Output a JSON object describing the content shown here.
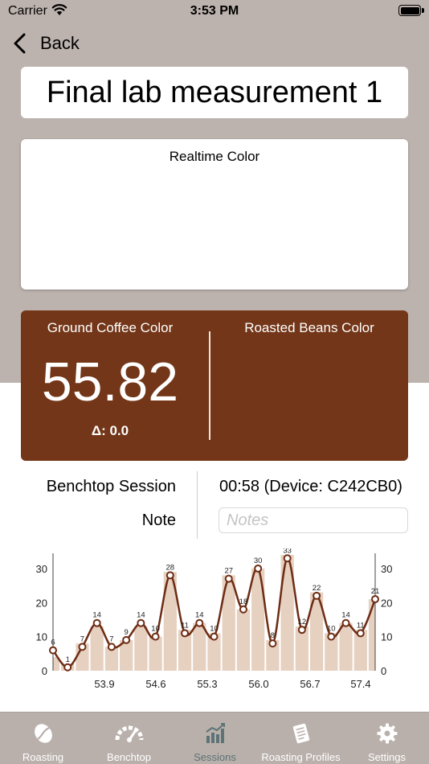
{
  "status_bar": {
    "carrier": "Carrier",
    "time": "3:53 PM"
  },
  "nav": {
    "back_label": "Back"
  },
  "title": "Final lab measurement 1",
  "realtime": {
    "label": "Realtime Color"
  },
  "color_panel": {
    "ground_label": "Ground Coffee Color",
    "roasted_label": "Roasted Beans Color",
    "value": "55.82",
    "delta": "Δ: 0.0",
    "background": "#733618"
  },
  "session": {
    "name": "Benchtop Session",
    "time_device": "00:58 (Device: C242CB0)",
    "note_label": "Note",
    "notes_placeholder": "Notes",
    "notes_value": ""
  },
  "chart_data": {
    "type": "line",
    "title": "",
    "xlabel": "",
    "ylabel": "",
    "x_tick_labels": [
      "53.9",
      "54.6",
      "55.3",
      "56.0",
      "56.7",
      "57.4"
    ],
    "y_ticks": [
      0,
      10,
      20,
      30
    ],
    "ylim": [
      0,
      34
    ],
    "grid": false,
    "values": [
      6,
      1,
      7,
      14,
      7,
      9,
      14,
      10,
      28,
      11,
      14,
      10,
      27,
      18,
      30,
      8,
      33,
      12,
      22,
      10,
      14,
      11,
      21
    ],
    "bar_values": [
      4,
      2,
      8,
      13,
      7,
      9,
      13,
      10,
      29,
      12,
      14,
      11,
      28,
      18,
      30,
      9,
      34,
      13,
      23,
      11,
      14,
      12,
      21
    ],
    "line_color": "#6e2c14",
    "bar_color": "#e6d0c0"
  },
  "tabbar": {
    "tabs": [
      {
        "label": "Roasting",
        "icon": "coffee-bean-icon",
        "active": false
      },
      {
        "label": "Benchtop",
        "icon": "gauge-icon",
        "active": false
      },
      {
        "label": "Sessions",
        "icon": "bar-chart-icon",
        "active": true
      },
      {
        "label": "Roasting Profiles",
        "icon": "profile-document-icon",
        "active": false
      },
      {
        "label": "Settings",
        "icon": "gear-icon",
        "active": false
      }
    ]
  },
  "colors": {
    "top_background": "#bdb3ae",
    "tabbar_background": "#b9b0ab",
    "active_tab": "#5c7377"
  }
}
